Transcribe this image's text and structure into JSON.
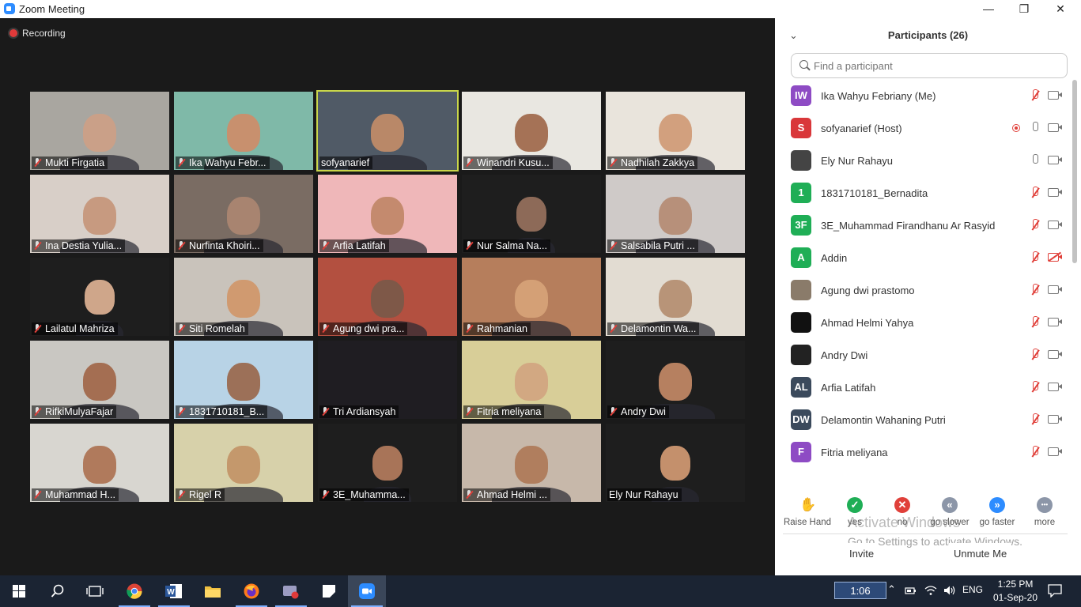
{
  "window": {
    "title": "Zoom Meeting",
    "minimize": "—",
    "restore": "❐",
    "close": "✕"
  },
  "meeting": {
    "recording_label": "Recording"
  },
  "tiles": [
    "Mukti Firgatia",
    "Ika Wahyu Febr...",
    "sofyanarief",
    "Winandri Kusu...",
    "Nadhilah Zakkya",
    "Ina Destia Yulia...",
    "Nurfinta Khoiri...",
    "Arfia Latifah",
    "Nur Salma Na...",
    "Salsabila Putri ...",
    "Lailatul Mahriza",
    "Siti Romelah",
    "Agung dwi pra...",
    "Rahmanian",
    "Delamontin Wa...",
    "RifkiMulyaFajar",
    "1831710181_B...",
    "Tri Ardiansyah",
    "Fitria meliyana",
    "Andry Dwi",
    "Muhammad H...",
    "Rigel R",
    "3E_Muhamma...",
    "Ahmad Helmi ...",
    "Ely Nur Rahayu"
  ],
  "tiles_active": "sofyanarief",
  "participants": {
    "title": "Participants (26)",
    "collapse_icon": "chevron-down-icon",
    "search_placeholder": "Find a participant",
    "list": [
      {
        "name": "Ika Wahyu Febriany (Me)",
        "initials": "IW",
        "color": "#8e4bc4",
        "mic": "muted",
        "cam": "on"
      },
      {
        "name": "sofyanarief (Host)",
        "initials": "S",
        "color": "#d9373a",
        "mic": "on",
        "cam": "on",
        "recording": true
      },
      {
        "name": "Ely Nur Rahayu",
        "initials": "",
        "color": "#444444",
        "mic": "on",
        "cam": "on"
      },
      {
        "name": "1831710181_Bernadita",
        "initials": "1",
        "color": "#1fae56",
        "mic": "muted",
        "cam": "on"
      },
      {
        "name": "3E_Muhammad Firandhanu Ar Rasyid",
        "initials": "3F",
        "color": "#1fae56",
        "mic": "muted",
        "cam": "on"
      },
      {
        "name": "Addin",
        "initials": "A",
        "color": "#1fae56",
        "mic": "muted",
        "cam": "off"
      },
      {
        "name": "Agung dwi prastomo",
        "initials": "",
        "color": "#8a7b6a",
        "mic": "muted",
        "cam": "on"
      },
      {
        "name": "Ahmad Helmi Yahya",
        "initials": "",
        "color": "#111111",
        "mic": "muted",
        "cam": "on"
      },
      {
        "name": "Andry Dwi",
        "initials": "",
        "color": "#222222",
        "mic": "muted",
        "cam": "on"
      },
      {
        "name": "Arfia Latifah",
        "initials": "AL",
        "color": "#3b4a5c",
        "mic": "muted",
        "cam": "on"
      },
      {
        "name": "Delamontin Wahaning Putri",
        "initials": "DW",
        "color": "#3b4a5c",
        "mic": "muted",
        "cam": "on"
      },
      {
        "name": "Fitria meliyana",
        "initials": "F",
        "color": "#8e4bc4",
        "mic": "muted",
        "cam": "on"
      }
    ]
  },
  "reactions": [
    {
      "label": "Raise Hand",
      "symbol": "✋",
      "color": "#2d8cff"
    },
    {
      "label": "yes",
      "symbol": "✓",
      "color": "#1fae56"
    },
    {
      "label": "no",
      "symbol": "✕",
      "color": "#e0403a"
    },
    {
      "label": "go slower",
      "symbol": "«",
      "color": "#8c96a8"
    },
    {
      "label": "go faster",
      "symbol": "»",
      "color": "#2d8cff"
    },
    {
      "label": "more",
      "symbol": "•••",
      "color": "#8c96a8"
    }
  ],
  "footer": {
    "invite": "Invite",
    "unmute_me": "Unmute Me"
  },
  "watermark": {
    "line1": "Activate Windows",
    "line2": "Go to Settings to activate Windows."
  },
  "taskbar": {
    "timer": "1:06",
    "language": "ENG",
    "time": "1:25 PM",
    "date": "01-Sep-20",
    "apps": [
      "windows-start-icon",
      "search-icon",
      "task-view-icon",
      "chrome-icon",
      "word-icon",
      "file-explorer-icon",
      "firefox-icon",
      "screen-recorder-icon",
      "sticky-notes-icon",
      "zoom-icon"
    ]
  }
}
